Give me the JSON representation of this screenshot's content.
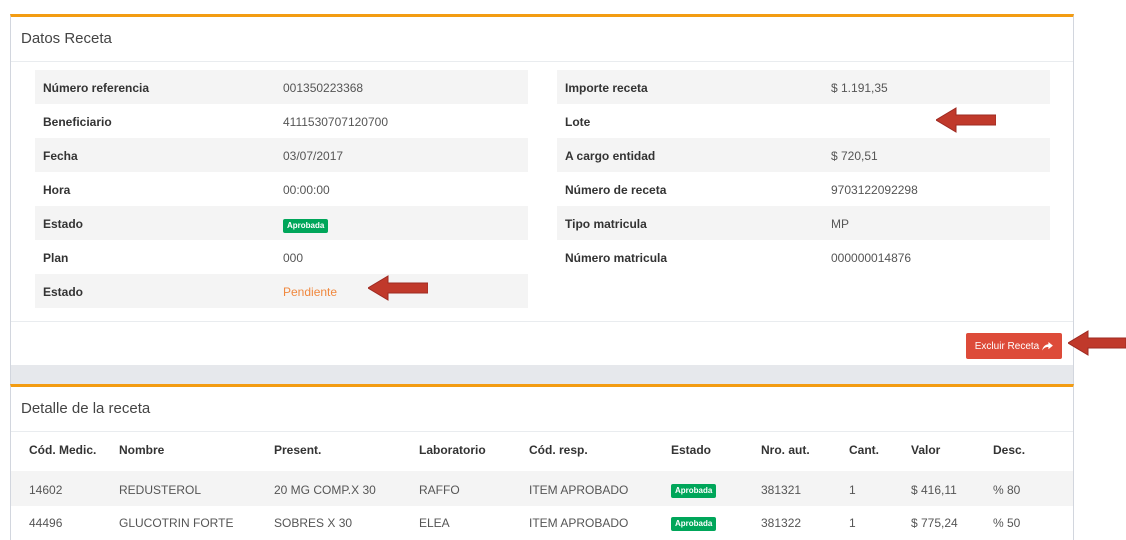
{
  "datos_receta": {
    "title": "Datos Receta",
    "left_rows": [
      {
        "label": "Número referencia",
        "value": "001350223368"
      },
      {
        "label": "Beneficiario",
        "value": "4111530707120700"
      },
      {
        "label": "Fecha",
        "value": "03/07/2017"
      },
      {
        "label": "Hora",
        "value": "00:00:00"
      },
      {
        "label": "Estado",
        "value": "Aprobada"
      },
      {
        "label": "Plan",
        "value": "000"
      },
      {
        "label": "Estado",
        "value": "Pendiente"
      }
    ],
    "right_rows": [
      {
        "label": "Importe receta",
        "value": "$ 1.191,35"
      },
      {
        "label": "Lote",
        "value": ""
      },
      {
        "label": "A cargo entidad",
        "value": "$ 720,51"
      },
      {
        "label": "Número de receta",
        "value": "9703122092298"
      },
      {
        "label": "Tipo matricula",
        "value": "MP"
      },
      {
        "label": "Número matricula",
        "value": "000000014876"
      }
    ],
    "exclude_button": "Excluir Receta"
  },
  "detalle": {
    "title": "Detalle de la receta",
    "columns": [
      "Cód. Medic.",
      "Nombre",
      "Present.",
      "Laboratorio",
      "Cód. resp.",
      "Estado",
      "Nro. aut.",
      "Cant.",
      "Valor",
      "Desc."
    ],
    "rows": [
      [
        "14602",
        "REDUSTEROL",
        "20 MG COMP.X 30",
        "RAFFO",
        "ITEM APROBADO",
        "Aprobada",
        "381321",
        "1",
        "$ 416,11",
        "% 80"
      ],
      [
        "44496",
        "GLUCOTRIN FORTE",
        "SOBRES X 30",
        "ELEA",
        "ITEM APROBADO",
        "Aprobada",
        "381322",
        "1",
        "$ 775,24",
        "% 50"
      ]
    ]
  },
  "colors": {
    "accent": "#f39c12",
    "approved": "#00a65a",
    "pending": "#f0883e",
    "danger": "#dd4b39",
    "arrow": "#c0392b"
  }
}
